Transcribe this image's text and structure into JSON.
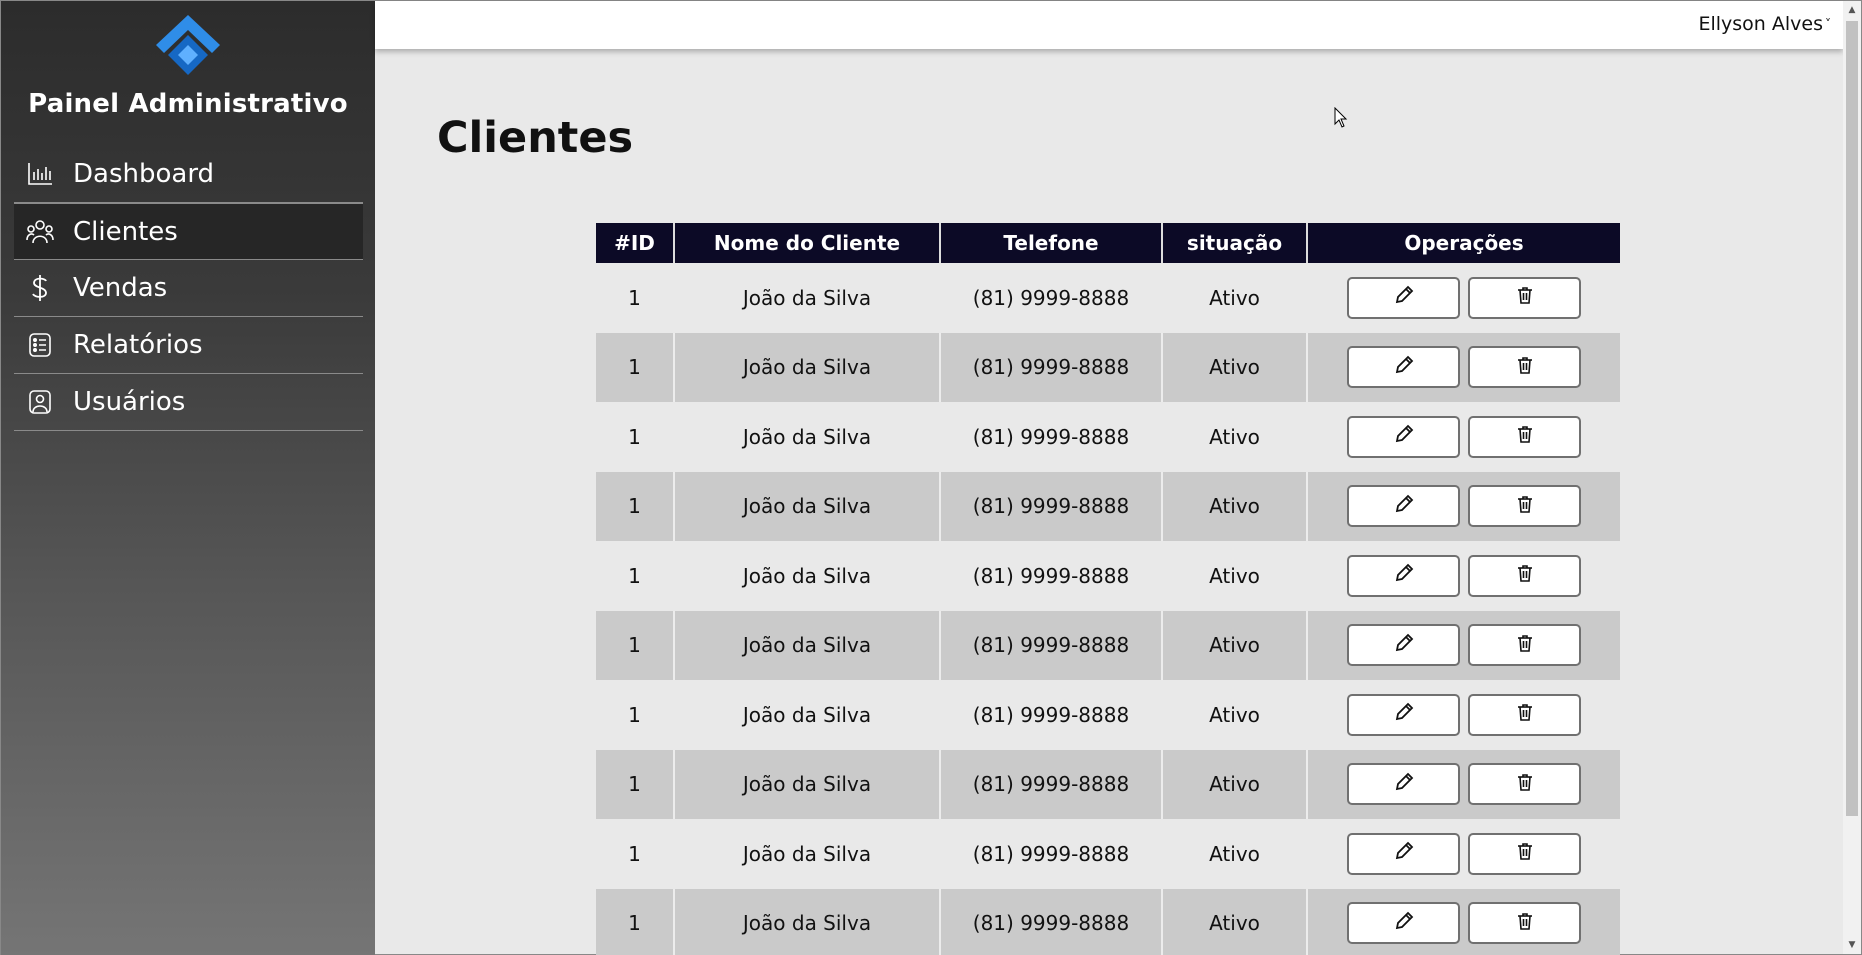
{
  "sidebar": {
    "brand": "Painel Administrativo",
    "items": [
      {
        "label": "Dashboard",
        "icon": "chart-icon",
        "active": false
      },
      {
        "label": "Clientes",
        "icon": "users-icon",
        "active": true
      },
      {
        "label": "Vendas",
        "icon": "dollar-icon",
        "active": false
      },
      {
        "label": "Relatórios",
        "icon": "report-list-icon",
        "active": false
      },
      {
        "label": "Usuários",
        "icon": "user-badge-icon",
        "active": false
      }
    ]
  },
  "header": {
    "user_name": "Ellyson Alves"
  },
  "main": {
    "title": "Clientes",
    "table": {
      "columns": [
        "#ID",
        "Nome do Cliente",
        "Telefone",
        "situação",
        "Operações"
      ],
      "rows": [
        {
          "id": "1",
          "name": "João da Silva",
          "phone": "(81) 9999-8888",
          "status": "Ativo"
        },
        {
          "id": "1",
          "name": "João da Silva",
          "phone": "(81) 9999-8888",
          "status": "Ativo"
        },
        {
          "id": "1",
          "name": "João da Silva",
          "phone": "(81) 9999-8888",
          "status": "Ativo"
        },
        {
          "id": "1",
          "name": "João da Silva",
          "phone": "(81) 9999-8888",
          "status": "Ativo"
        },
        {
          "id": "1",
          "name": "João da Silva",
          "phone": "(81) 9999-8888",
          "status": "Ativo"
        },
        {
          "id": "1",
          "name": "João da Silva",
          "phone": "(81) 9999-8888",
          "status": "Ativo"
        },
        {
          "id": "1",
          "name": "João da Silva",
          "phone": "(81) 9999-8888",
          "status": "Ativo"
        },
        {
          "id": "1",
          "name": "João da Silva",
          "phone": "(81) 9999-8888",
          "status": "Ativo"
        },
        {
          "id": "1",
          "name": "João da Silva",
          "phone": "(81) 9999-8888",
          "status": "Ativo"
        },
        {
          "id": "1",
          "name": "João da Silva",
          "phone": "(81) 9999-8888",
          "status": "Ativo"
        }
      ]
    }
  },
  "colors": {
    "sidebar_top": "#2c2c2c",
    "sidebar_bottom": "#757575",
    "table_header": "#0c0a26",
    "row_alt": "#cacaca",
    "logo_blue": "#1e7fe0"
  }
}
